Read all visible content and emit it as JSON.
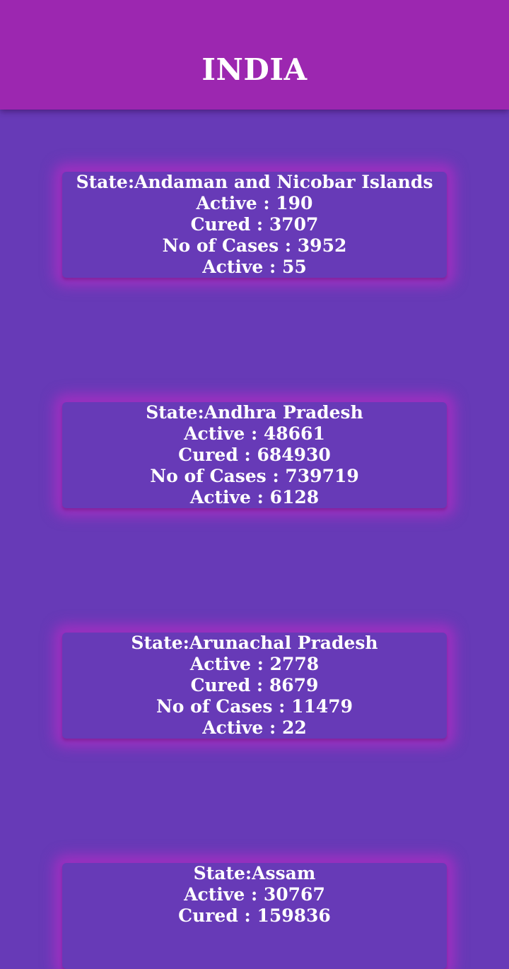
{
  "header": {
    "title": "INDIA"
  },
  "states": [
    {
      "state_label": "State:Andaman and Nicobar Islands",
      "active_label": "Active : 190",
      "cured_label": "Cured : 3707",
      "cases_label": "No of Cases : 3952",
      "active2_label": "Active : 55"
    },
    {
      "state_label": "State:Andhra Pradesh",
      "active_label": "Active : 48661",
      "cured_label": "Cured : 684930",
      "cases_label": "No of Cases : 739719",
      "active2_label": "Active : 6128"
    },
    {
      "state_label": "State:Arunachal Pradesh",
      "active_label": "Active : 2778",
      "cured_label": "Cured : 8679",
      "cases_label": "No of Cases : 11479",
      "active2_label": "Active : 22"
    },
    {
      "state_label": "State:Assam",
      "active_label": "Active : 30767",
      "cured_label": "Cured : 159836"
    }
  ]
}
